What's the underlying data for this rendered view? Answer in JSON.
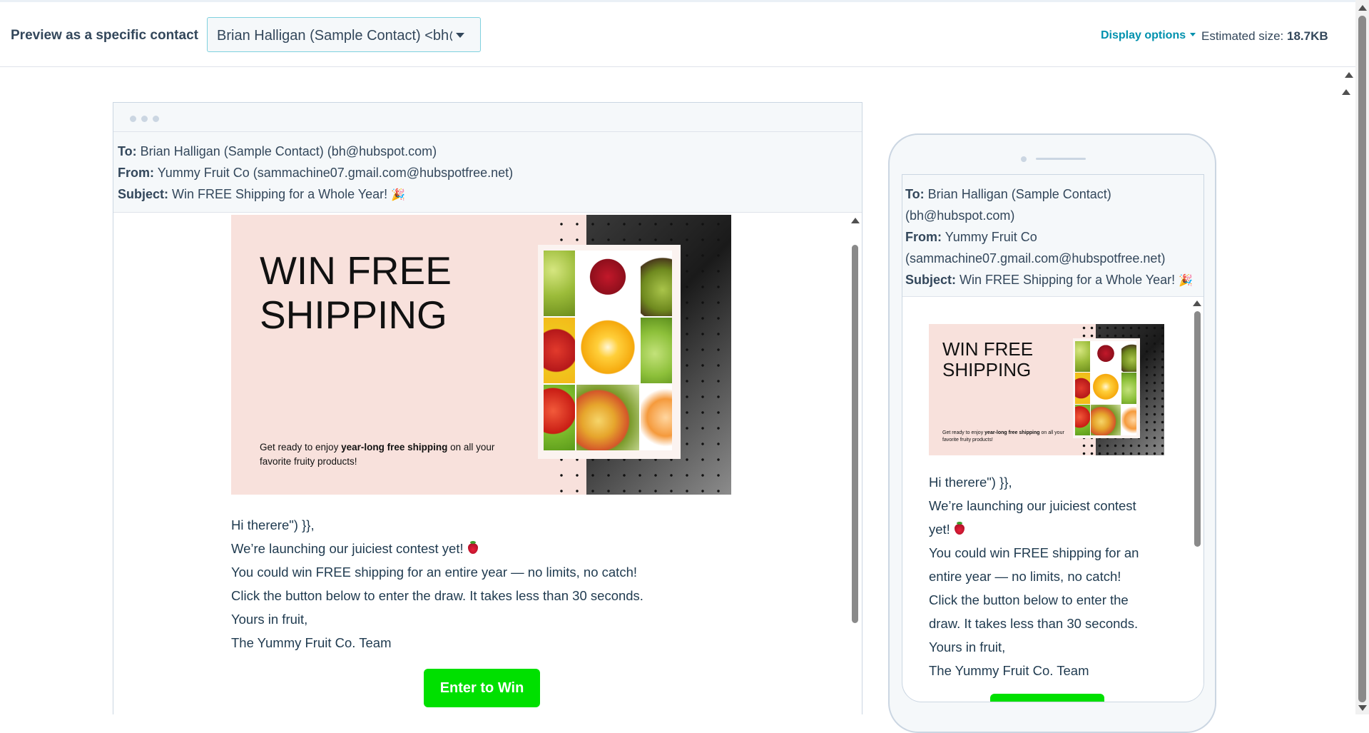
{
  "topbar": {
    "preview_label": "Preview as a specific contact",
    "contact_value": "Brian Halligan (Sample Contact) <bh@hubspot.com>",
    "display_options": "Display options",
    "estimated_size_label": "Estimated size:",
    "estimated_size_value": "18.7KB"
  },
  "email": {
    "to_label": "To:",
    "to_value": "Brian Halligan (Sample Contact) (bh@hubspot.com)",
    "to_value_line1": "Brian Halligan (Sample Contact)",
    "to_value_line2": "(bh@hubspot.com)",
    "from_label": "From:",
    "from_value": "Yummy Fruit Co (sammachine07.gmail.com@hubspotfree.net)",
    "from_value_line1": "Yummy Fruit Co",
    "from_value_line2": "(sammachine07.gmail.com@hubspotfree.net)",
    "subject_label": "Subject:",
    "subject_value": "Win FREE Shipping for a Whole Year!",
    "subject_emoji": "🎉"
  },
  "banner": {
    "title_line1": "WIN FREE",
    "title_line2": "SHIPPING",
    "blurb_prefix": "Get ready to enjoy ",
    "blurb_bold": "year-long free shipping",
    "blurb_suffix": " on all your favorite fruity products!"
  },
  "body": {
    "greeting": "Hi therere\") }},",
    "line1": "We’re launching our juiciest contest yet!",
    "line2": "You could win FREE shipping for an entire year — no limits, no catch!",
    "line3": "Click the button below to enter the draw. It takes less than 30 seconds.",
    "signoff": "Yours in fruit,",
    "team": "The Yummy Fruit Co. Team",
    "mobile_line1a": "We’re launching our juiciest contest",
    "mobile_line1b": "yet!",
    "mobile_line2a": "You could win FREE shipping for an",
    "mobile_line2b": "entire year — no limits, no catch!",
    "mobile_line3a": "Click the button below to enter the",
    "mobile_line3b": "draw. It takes less than 30 seconds."
  },
  "cta": {
    "label": "Enter to Win",
    "color": "#00e000"
  },
  "icons": {
    "caret": "chevron-down-icon",
    "strawberry": "strawberry-emoji",
    "party": "party-popper-emoji"
  }
}
